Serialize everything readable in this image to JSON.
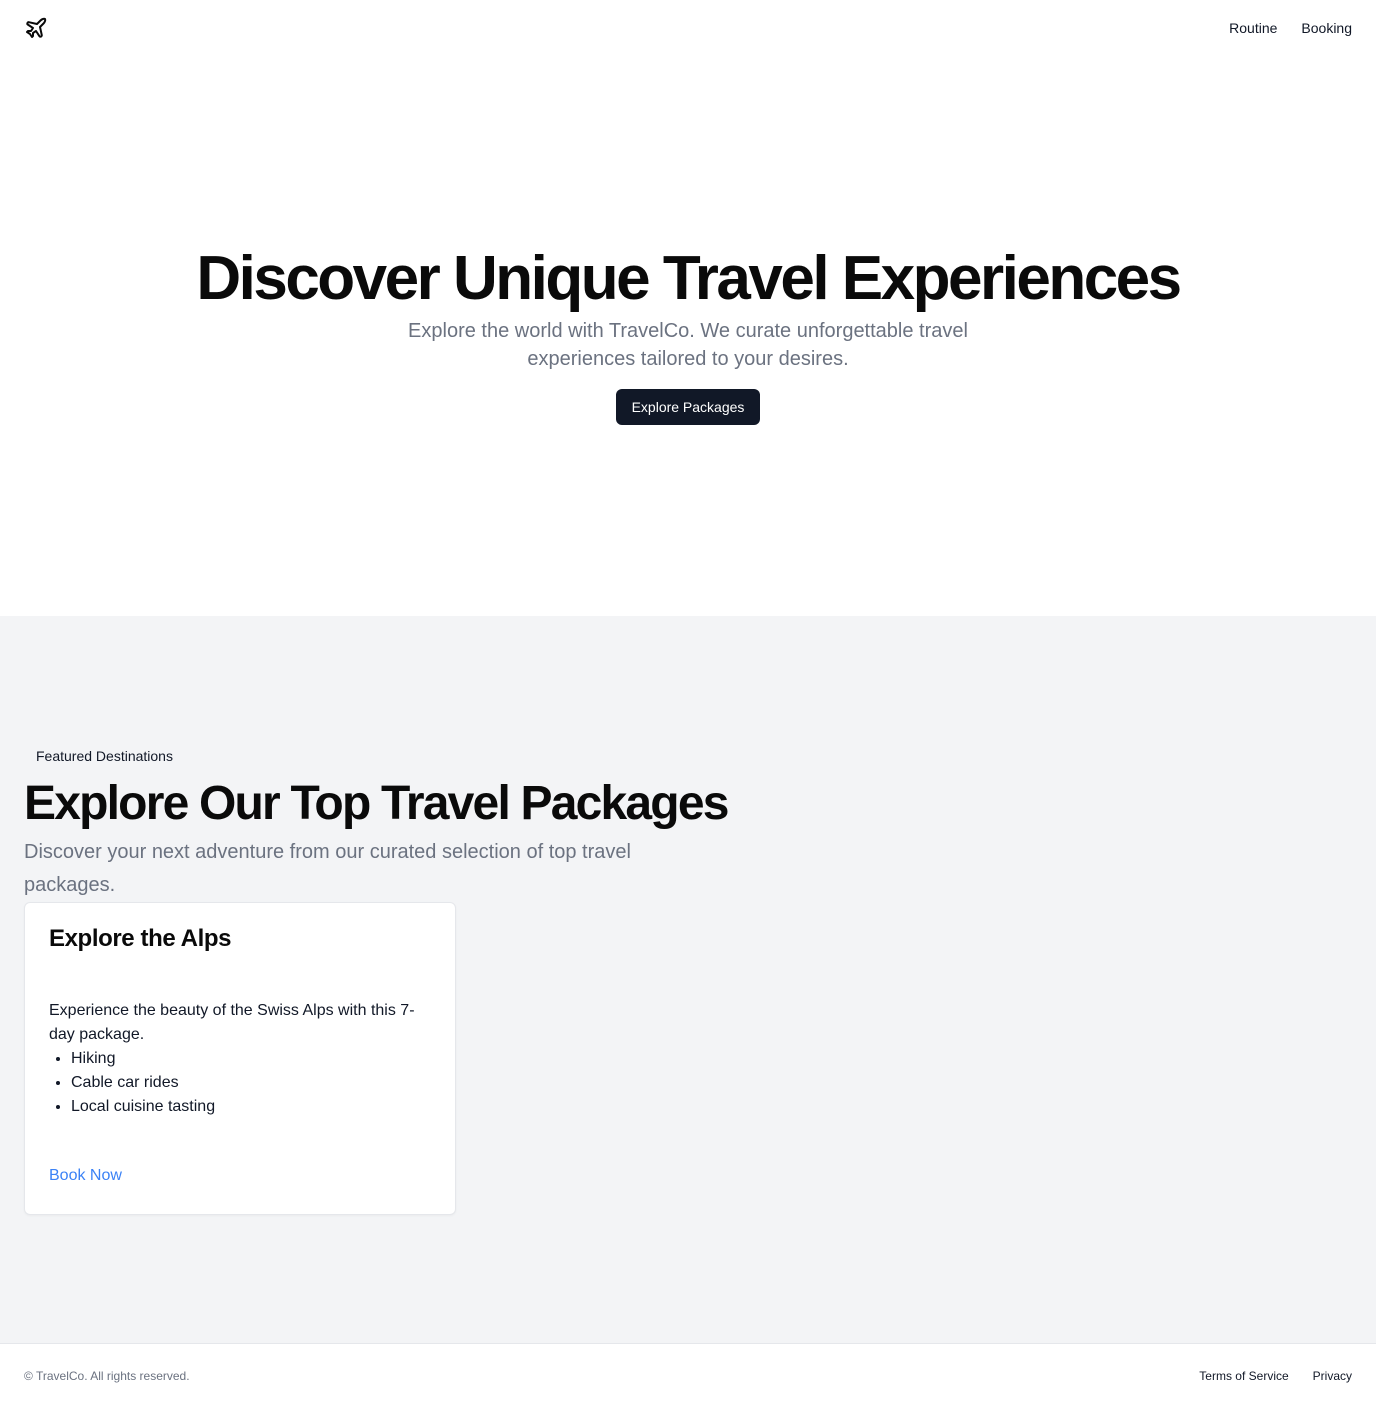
{
  "header": {
    "logo_icon": "plane-icon",
    "nav": [
      {
        "label": "Routine"
      },
      {
        "label": "Booking"
      }
    ]
  },
  "hero": {
    "title": "Discover Unique Travel Experiences",
    "subtitle": "Explore the world with TravelCo. We curate unforgettable travel experiences tailored to your desires.",
    "cta_label": "Explore Packages"
  },
  "packages": {
    "badge": "Featured Destinations",
    "title": "Explore Our Top Travel Packages",
    "subtitle": "Discover your next adventure from our curated selection of top travel packages.",
    "cards": [
      {
        "title": "Explore the Alps",
        "description": "Experience the beauty of the Swiss Alps with this 7-day package.",
        "features": [
          "Hiking",
          "Cable car rides",
          "Local cuisine tasting"
        ],
        "link_label": "Book Now"
      }
    ]
  },
  "footer": {
    "copyright": "© TravelCo. All rights reserved.",
    "links": [
      {
        "label": "Terms of Service"
      },
      {
        "label": "Privacy"
      }
    ]
  },
  "colors": {
    "primary_button": "#111827",
    "link": "#3b82f6",
    "muted_text": "#6b7280",
    "section_bg": "#f3f4f6"
  }
}
